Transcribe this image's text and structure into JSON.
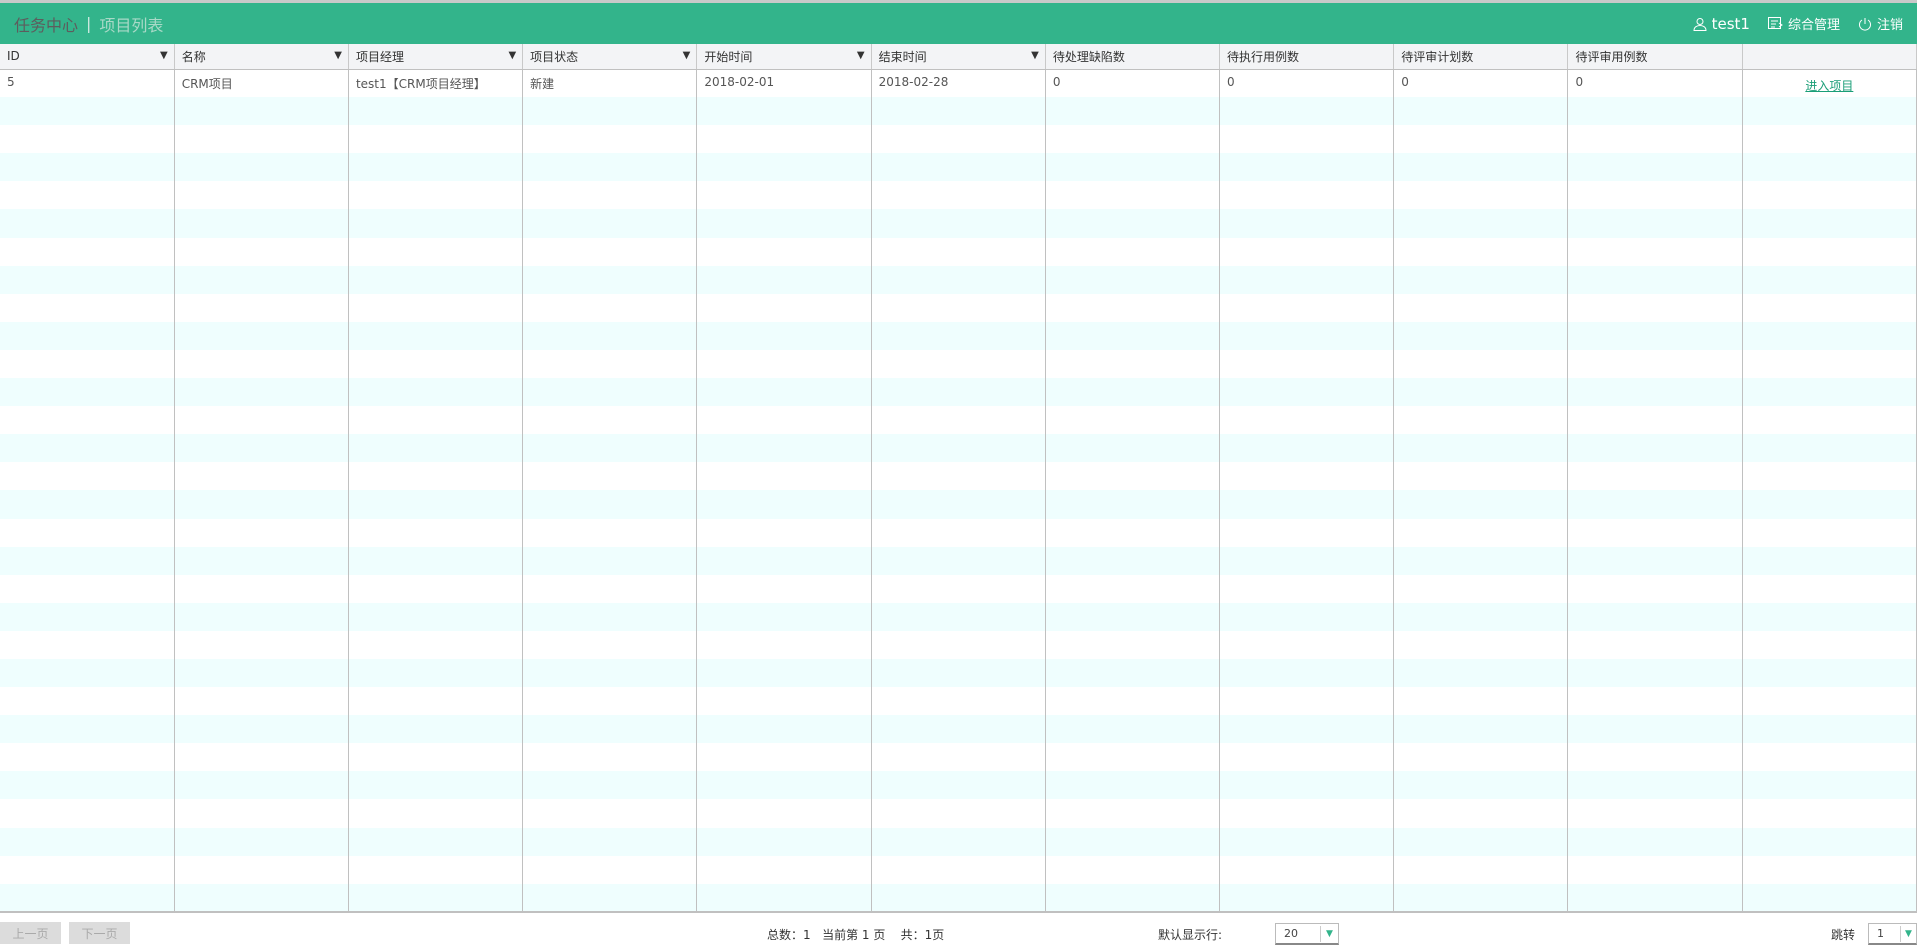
{
  "header": {
    "title": "任务中心",
    "subtitle": "项目列表",
    "user": "test1",
    "admin": "综合管理",
    "logout": "注销"
  },
  "columns": [
    "ID",
    "名称",
    "项目经理",
    "项目状态",
    "开始时间",
    "结束时间",
    "待处理缺陷数",
    "待执行用例数",
    "待评审计划数",
    "待评审用例数",
    ""
  ],
  "filterable": [
    true,
    true,
    true,
    true,
    true,
    true,
    false,
    false,
    false,
    false,
    false
  ],
  "rows": [
    [
      "5",
      "CRM项目",
      "test1【CRM项目经理】",
      "新建",
      "2018-02-01",
      "2018-02-28",
      "0",
      "0",
      "0",
      "0",
      "进入项目"
    ]
  ],
  "footer": {
    "prev": "上一页",
    "next": "下一页",
    "total": "总数：1   当前第 1 页    共：1页",
    "rows_label": "默认显示行:",
    "rows_value": "20",
    "jump_label": "跳转",
    "jump_value": "1"
  }
}
